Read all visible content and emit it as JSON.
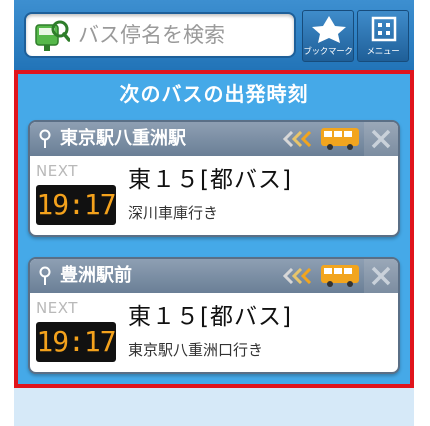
{
  "header": {
    "search_placeholder": "バス停名を検索",
    "bookmark_label": "ブックマーク",
    "menu_label": "メニュー"
  },
  "section": {
    "title": "次のバスの出発時刻"
  },
  "stops": [
    {
      "name": "東京駅八重洲駅",
      "next_label": "NEXT",
      "time": "19:17",
      "route": "東１５[都バス]",
      "destination": "深川車庫行き"
    },
    {
      "name": "豊洲駅前",
      "next_label": "NEXT",
      "time": "19:17",
      "route": "東１５[都バス]",
      "destination": "東京駅八重洲口行き"
    }
  ],
  "colors": {
    "header": "#2f83c6",
    "highlight_border": "#e0141c",
    "section_bg": "#45a9e8",
    "time_digits": "#f4a21c",
    "bus_icon": "#f2a51e"
  },
  "icons": [
    "bus-stop-search-icon",
    "star-icon",
    "menu-grid-icon",
    "pin-icon",
    "approaching-arrows-icon",
    "bus-icon",
    "close-icon"
  ]
}
